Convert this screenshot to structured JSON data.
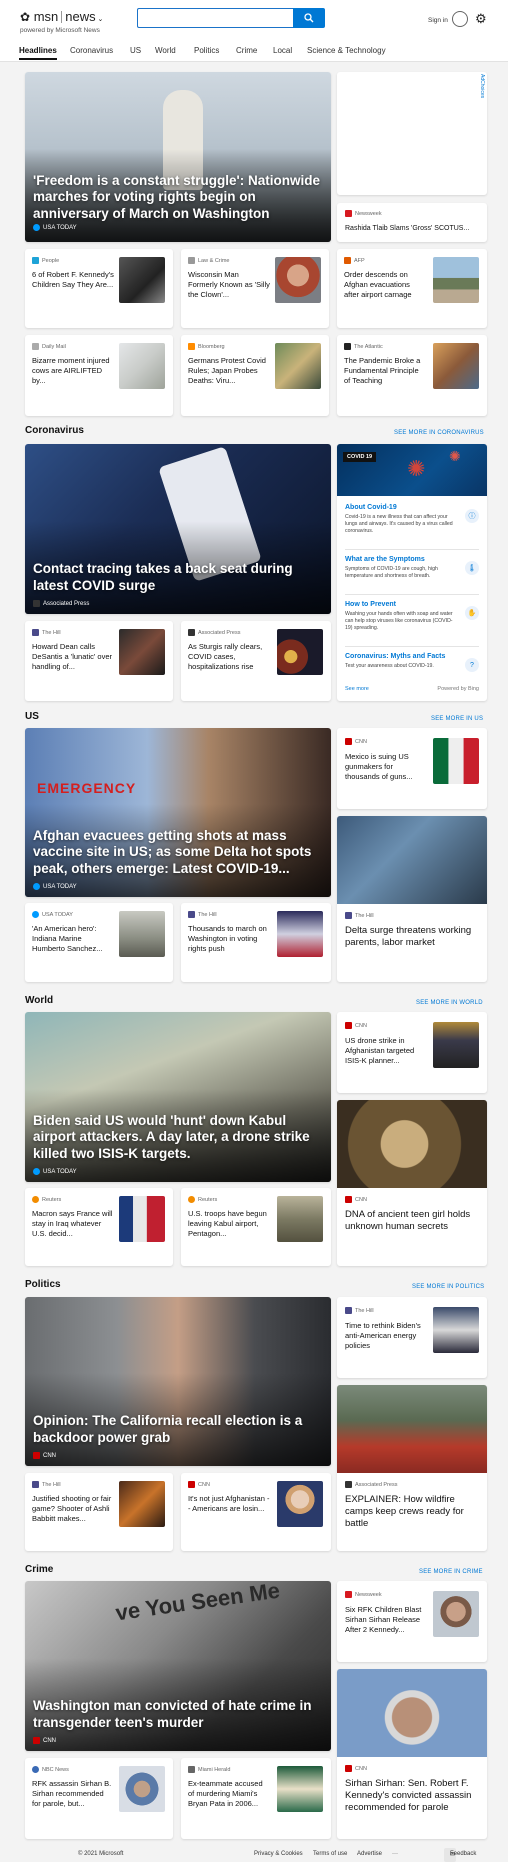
{
  "header": {
    "brand": "msn",
    "section": "news",
    "powered": "powered by Microsoft News",
    "search_placeholder": "",
    "signin": "Sign in"
  },
  "nav": [
    "Headlines",
    "Coronavirus",
    "US",
    "World",
    "Politics",
    "Crime",
    "Local",
    "Science & Technology"
  ],
  "adchoices": "AdChoices",
  "top": {
    "hero": {
      "title": "'Freedom is a constant struggle': Nationwide marches for voting rights begin on anniversary of March on Washington",
      "source": "USA TODAY"
    },
    "side": {
      "source": "Newsweek",
      "title": "Rashida Tlaib Slams 'Gross' SCOTUS..."
    },
    "row1": [
      {
        "source": "People",
        "title": "6 of Robert F. Kennedy's Children Say They Are..."
      },
      {
        "source": "Law & Crime",
        "title": "Wisconsin Man Formerly Known as 'Silly the Clown'..."
      },
      {
        "source": "AFP",
        "title": "Order descends on Afghan evacuations after airport carnage"
      }
    ],
    "row2": [
      {
        "source": "Daily Mail",
        "title": "Bizarre moment injured cows are AIRLIFTED by..."
      },
      {
        "source": "Bloomberg",
        "title": "Germans Protest Covid Rules; Japan Probes Deaths: Viru..."
      },
      {
        "source": "The Atlantic",
        "title": "The Pandemic Broke a Fundamental Principle of Teaching"
      }
    ]
  },
  "coronavirus": {
    "title": "Coronavirus",
    "see_more": "SEE MORE IN CORONAVIRUS",
    "hero": {
      "title": "Contact tracing takes a back seat during latest COVID surge",
      "source": "Associated Press"
    },
    "smalls": [
      {
        "source": "The Hill",
        "title": "Howard Dean calls DeSantis a 'lunatic' over handling of..."
      },
      {
        "source": "Associated Press",
        "title": "As Sturgis rally clears, COVID cases, hospitalizations rise"
      }
    ],
    "panel": {
      "badge": "COVID 19",
      "items": [
        {
          "title": "About Covid-19",
          "desc": "Covid-19 is a new illness that can affect your lungs and airways. It's caused by a virus called coronavirus."
        },
        {
          "title": "What are the Symptoms",
          "desc": "Symptoms of COVID-19 are cough, high temperature and shortness of breath."
        },
        {
          "title": "How to Prevent",
          "desc": "Washing your hands often with soap and water can help stop viruses like coronavirus (COVID-19) spreading."
        },
        {
          "title": "Coronavirus: Myths and Facts",
          "desc": "Test your awareness about COVID-19."
        }
      ],
      "see_more": "See more",
      "powered": "Powered by Bing"
    }
  },
  "us": {
    "title": "US",
    "see_more": "SEE MORE IN US",
    "hero": {
      "title": "Afghan evacuees getting shots at mass vaccine site in US; as some Delta hot spots peak, others emerge: Latest COVID-19...",
      "source": "USA TODAY",
      "sign": "EMERGENCY"
    },
    "side": {
      "source": "CNN",
      "title": "Mexico is suing US gunmakers for thousands of guns..."
    },
    "tall": {
      "source": "The Hill",
      "title": "Delta surge threatens working parents, labor market"
    },
    "smalls": [
      {
        "source": "USA TODAY",
        "title": "'An American hero': Indiana Marine Humberto Sanchez..."
      },
      {
        "source": "The Hill",
        "title": "Thousands to march on Washington in voting rights push"
      }
    ]
  },
  "world": {
    "title": "World",
    "see_more": "SEE MORE IN WORLD",
    "hero": {
      "title": "Biden said US would 'hunt' down Kabul airport attackers. A day later, a drone strike killed two ISIS-K targets.",
      "source": "USA TODAY"
    },
    "side": {
      "source": "CNN",
      "title": "US drone strike in Afghanistan targeted ISIS-K planner..."
    },
    "tall": {
      "source": "CNN",
      "title": "DNA of ancient teen girl holds unknown human secrets"
    },
    "smalls": [
      {
        "source": "Reuters",
        "title": "Macron says France will stay in Iraq whatever U.S. decid..."
      },
      {
        "source": "Reuters",
        "title": "U.S. troops have begun leaving Kabul airport, Pentagon..."
      }
    ]
  },
  "politics": {
    "title": "Politics",
    "see_more": "SEE MORE IN POLITICS",
    "hero": {
      "title": "Opinion: The California recall election is a backdoor power grab",
      "source": "CNN"
    },
    "side": {
      "source": "The Hill",
      "title": "Time to rethink Biden's anti-American energy policies"
    },
    "tall": {
      "source": "Associated Press",
      "title": "EXPLAINER: How wildfire camps keep crews ready for battle"
    },
    "smalls": [
      {
        "source": "The Hill",
        "title": "Justified shooting or fair game? Shooter of Ashli Babbitt makes..."
      },
      {
        "source": "CNN",
        "title": "It's not just Afghanistan -- Americans are losin..."
      }
    ]
  },
  "crime": {
    "title": "Crime",
    "see_more": "SEE MORE IN CRIME",
    "hero": {
      "title": "Washington man convicted of hate crime in transgender teen's murder",
      "source": "CNN",
      "poster": "ve You Seen Me"
    },
    "side": {
      "source": "Newsweek",
      "title": "Six RFK Children Blast Sirhan Sirhan Release After 2 Kennedy..."
    },
    "tall": {
      "source": "CNN",
      "title": "Sirhan Sirhan: Sen. Robert F. Kennedy's convicted assassin recommended for parole"
    },
    "smalls": [
      {
        "source": "NBC News",
        "title": "RFK assassin Sirhan B. Sirhan recommended for parole, but..."
      },
      {
        "source": "Miami Herald",
        "title": "Ex-teammate accused of murdering Miami's Bryan Pata in 2006..."
      }
    ]
  },
  "footer": {
    "copyright": "© 2021 Microsoft",
    "privacy": "Privacy & Cookies",
    "terms": "Terms of use",
    "advertise": "Advertise",
    "more": "···",
    "feedback": "Feedback"
  },
  "colors": {
    "accent": "#0078d4",
    "cnn": "#cc0000",
    "newsweek": "#d71920",
    "usatoday": "#009bff"
  }
}
